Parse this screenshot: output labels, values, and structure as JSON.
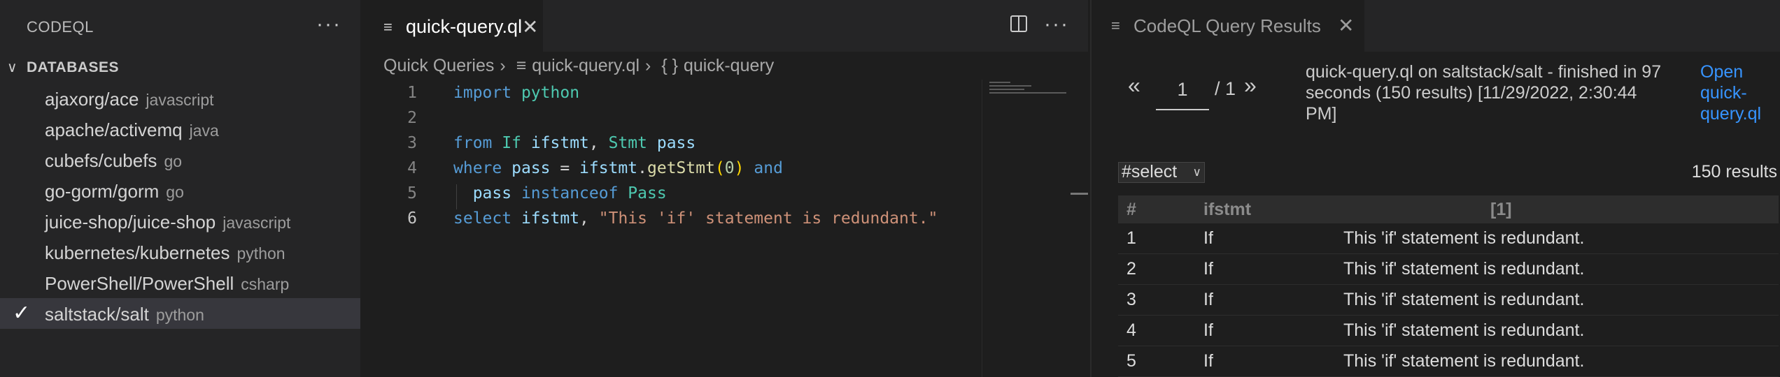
{
  "sidebar": {
    "header": "CODEQL",
    "section": "DATABASES",
    "databases": [
      {
        "name": "ajaxorg/ace",
        "lang": "javascript",
        "selected": false
      },
      {
        "name": "apache/activemq",
        "lang": "java",
        "selected": false
      },
      {
        "name": "cubefs/cubefs",
        "lang": "go",
        "selected": false
      },
      {
        "name": "go-gorm/gorm",
        "lang": "go",
        "selected": false
      },
      {
        "name": "juice-shop/juice-shop",
        "lang": "javascript",
        "selected": false
      },
      {
        "name": "kubernetes/kubernetes",
        "lang": "python",
        "selected": false
      },
      {
        "name": "PowerShell/PowerShell",
        "lang": "csharp",
        "selected": false
      },
      {
        "name": "saltstack/salt",
        "lang": "python",
        "selected": true
      }
    ]
  },
  "editor": {
    "tab_title": "quick-query.ql",
    "breadcrumb": {
      "folder": "Quick Queries",
      "file": "quick-query.ql",
      "symbol": "quick-query"
    },
    "line_numbers": [
      "1",
      "2",
      "3",
      "4",
      "5",
      "6"
    ],
    "code": {
      "l1_import": "import",
      "l1_module": "python",
      "l3_from": "from",
      "l3_type1": "If",
      "l3_var1": "ifstmt",
      "l3_type2": "Stmt",
      "l3_var2": "pass",
      "l4_where": "where",
      "l4_var": "pass",
      "l4_obj": "ifstmt",
      "l4_method": "getStmt",
      "l4_arg": "0",
      "l4_and": "and",
      "l5_var": "pass",
      "l5_instanceof": "instanceof",
      "l5_type": "Pass",
      "l6_select": "select",
      "l6_var": "ifstmt",
      "l6_string": "\"This 'if' statement is redundant.\""
    }
  },
  "results": {
    "tab_title": "CodeQL Query Results",
    "page_current": "1",
    "page_total": "/ 1",
    "summary": "quick-query.ql on saltstack/salt - finished in 97 seconds (150 results) [11/29/2022, 2:30:44 PM]",
    "open_link": "Open quick-query.ql",
    "result_set": "#select",
    "result_count": "150 results",
    "columns": [
      "#",
      "ifstmt",
      "[1]"
    ],
    "rows": [
      {
        "n": "1",
        "ifstmt": "If",
        "msg": "This 'if' statement is redundant."
      },
      {
        "n": "2",
        "ifstmt": "If",
        "msg": "This 'if' statement is redundant."
      },
      {
        "n": "3",
        "ifstmt": "If",
        "msg": "This 'if' statement is redundant."
      },
      {
        "n": "4",
        "ifstmt": "If",
        "msg": "This 'if' statement is redundant."
      },
      {
        "n": "5",
        "ifstmt": "If",
        "msg": "This 'if' statement is redundant."
      }
    ]
  },
  "icons": {
    "more": "more-actions-icon",
    "chevron": "chevron-down-icon",
    "check": "checkmark-icon",
    "file": "file-lines-icon",
    "close": "close-icon",
    "split": "split-editor-icon",
    "prev": "previous-page-icon",
    "next": "next-page-icon"
  },
  "colors": {
    "link": "#3794ff",
    "keyword": "#569cd6",
    "type": "#4ec9b0",
    "string": "#ce9178"
  }
}
